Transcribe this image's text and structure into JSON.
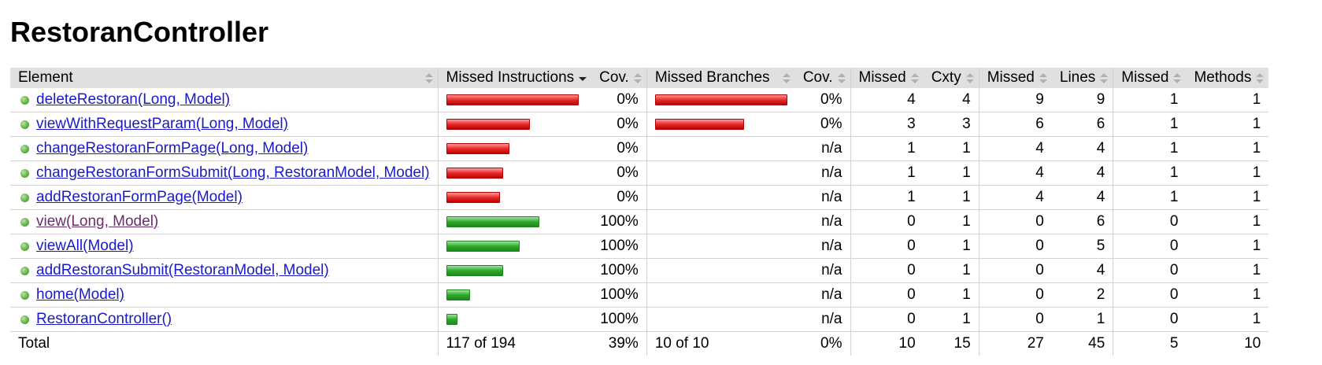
{
  "title": "RestoranController",
  "headers": {
    "element": "Element",
    "missed_instructions": "Missed Instructions",
    "cov1": "Cov.",
    "missed_branches": "Missed Branches",
    "cov2": "Cov.",
    "missed_cxty": "Missed",
    "cxty": "Cxty",
    "missed_lines": "Missed",
    "lines": "Lines",
    "missed_methods": "Missed",
    "methods": "Methods"
  },
  "rows": [
    {
      "name": "deleteRestoran(Long, Model)",
      "visited": false,
      "instr_color": "red",
      "instr_fraction": 1.0,
      "instr_cov": "0%",
      "branch_color": "red",
      "branch_fraction": 1.0,
      "branch_cov": "0%",
      "missed_cxty": "4",
      "cxty": "4",
      "missed_lines": "9",
      "lines": "9",
      "missed_methods": "1",
      "methods": "1"
    },
    {
      "name": "viewWithRequestParam(Long, Model)",
      "visited": false,
      "instr_color": "red",
      "instr_fraction": 0.631,
      "instr_cov": "0%",
      "branch_color": "red",
      "branch_fraction": 0.67,
      "branch_cov": "0%",
      "missed_cxty": "3",
      "cxty": "3",
      "missed_lines": "6",
      "lines": "6",
      "missed_methods": "1",
      "methods": "1"
    },
    {
      "name": "changeRestoranFormPage(Long, Model)",
      "visited": false,
      "instr_color": "red",
      "instr_fraction": 0.476,
      "instr_cov": "0%",
      "branch_color": "",
      "branch_fraction": 0,
      "branch_cov": "n/a",
      "missed_cxty": "1",
      "cxty": "1",
      "missed_lines": "4",
      "lines": "4",
      "missed_methods": "1",
      "methods": "1"
    },
    {
      "name": "changeRestoranFormSubmit(Long, RestoranModel, Model)",
      "visited": false,
      "instr_color": "red",
      "instr_fraction": 0.429,
      "instr_cov": "0%",
      "branch_color": "",
      "branch_fraction": 0,
      "branch_cov": "n/a",
      "missed_cxty": "1",
      "cxty": "1",
      "missed_lines": "4",
      "lines": "4",
      "missed_methods": "1",
      "methods": "1"
    },
    {
      "name": "addRestoranFormPage(Model)",
      "visited": false,
      "instr_color": "red",
      "instr_fraction": 0.405,
      "instr_cov": "0%",
      "branch_color": "",
      "branch_fraction": 0,
      "branch_cov": "n/a",
      "missed_cxty": "1",
      "cxty": "1",
      "missed_lines": "4",
      "lines": "4",
      "missed_methods": "1",
      "methods": "1"
    },
    {
      "name": "view(Long, Model)",
      "visited": true,
      "instr_color": "green",
      "instr_fraction": 0.702,
      "instr_cov": "100%",
      "branch_color": "",
      "branch_fraction": 0,
      "branch_cov": "n/a",
      "missed_cxty": "0",
      "cxty": "1",
      "missed_lines": "0",
      "lines": "6",
      "missed_methods": "0",
      "methods": "1"
    },
    {
      "name": "viewAll(Model)",
      "visited": false,
      "instr_color": "green",
      "instr_fraction": 0.554,
      "instr_cov": "100%",
      "branch_color": "",
      "branch_fraction": 0,
      "branch_cov": "n/a",
      "missed_cxty": "0",
      "cxty": "1",
      "missed_lines": "0",
      "lines": "5",
      "missed_methods": "0",
      "methods": "1"
    },
    {
      "name": "addRestoranSubmit(RestoranModel, Model)",
      "visited": false,
      "instr_color": "green",
      "instr_fraction": 0.429,
      "instr_cov": "100%",
      "branch_color": "",
      "branch_fraction": 0,
      "branch_cov": "n/a",
      "missed_cxty": "0",
      "cxty": "1",
      "missed_lines": "0",
      "lines": "4",
      "missed_methods": "0",
      "methods": "1"
    },
    {
      "name": "home(Model)",
      "visited": false,
      "instr_color": "green",
      "instr_fraction": 0.179,
      "instr_cov": "100%",
      "branch_color": "",
      "branch_fraction": 0,
      "branch_cov": "n/a",
      "missed_cxty": "0",
      "cxty": "1",
      "missed_lines": "0",
      "lines": "2",
      "missed_methods": "0",
      "methods": "1"
    },
    {
      "name": "RestoranController()",
      "visited": false,
      "instr_color": "green",
      "instr_fraction": 0.083,
      "instr_cov": "100%",
      "branch_color": "",
      "branch_fraction": 0,
      "branch_cov": "n/a",
      "missed_cxty": "0",
      "cxty": "1",
      "missed_lines": "0",
      "lines": "1",
      "missed_methods": "0",
      "methods": "1"
    }
  ],
  "total": {
    "label": "Total",
    "instructions": "117 of 194",
    "instr_cov": "39%",
    "branches": "10 of 10",
    "branch_cov": "0%",
    "missed_cxty": "10",
    "cxty": "15",
    "missed_lines": "27",
    "lines": "45",
    "missed_methods": "5",
    "methods": "10"
  },
  "colors": {
    "red_bar": "#e62a2a",
    "green_bar": "#2eaa2e",
    "link": "#1a1ac8",
    "visited_link": "#6b2c6b",
    "header_bg": "#e0e0e0"
  },
  "icons": {
    "element_dot": "green-method-dot-icon",
    "sort": "sort-arrows-icon"
  }
}
